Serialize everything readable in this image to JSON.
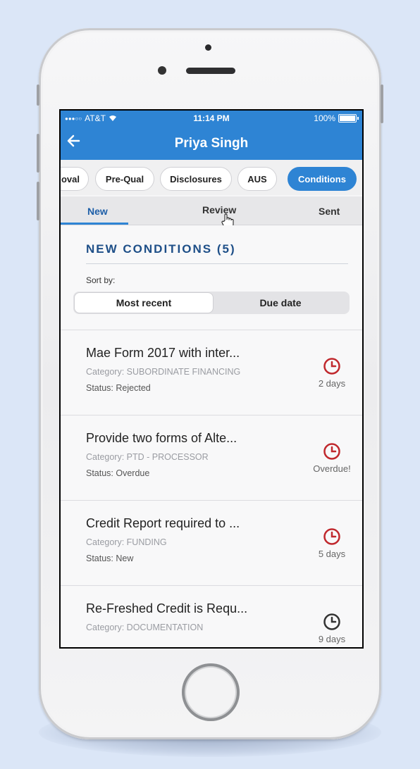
{
  "status_bar": {
    "carrier": "AT&T",
    "time": "11:14 PM",
    "battery": "100%"
  },
  "header": {
    "title": "Priya Singh"
  },
  "chips": [
    "oval",
    "Pre-Qual",
    "Disclosures",
    "AUS",
    "Conditions"
  ],
  "tabs": {
    "new": "New",
    "review": "Review",
    "sent": "Sent"
  },
  "section": {
    "title": "NEW CONDITIONS (5)"
  },
  "sort": {
    "label": "Sort by:",
    "option1": "Most recent",
    "option2": "Due date"
  },
  "conditions": [
    {
      "title": "Mae Form 2017 with inter...",
      "category": "Category: SUBORDINATE FINANCING",
      "status": "Status: Rejected",
      "due": "2 days",
      "clock_color": "#c0282d"
    },
    {
      "title": "Provide two forms of Alte...",
      "category": "Category: PTD - PROCESSOR",
      "status": "Status: Overdue",
      "due": "Overdue!",
      "clock_color": "#c0282d"
    },
    {
      "title": "Credit Report required to ...",
      "category": "Category: FUNDING",
      "status": "Status: New",
      "due": "5 days",
      "clock_color": "#c0282d"
    },
    {
      "title": "Re-Freshed Credit is Requ...",
      "category": "Category: DOCUMENTATION",
      "status": "",
      "due": "9 days",
      "clock_color": "#333333"
    }
  ],
  "colors": {
    "primary": "#2e84d4",
    "heading": "#1e4f88",
    "alert": "#c0282d"
  }
}
